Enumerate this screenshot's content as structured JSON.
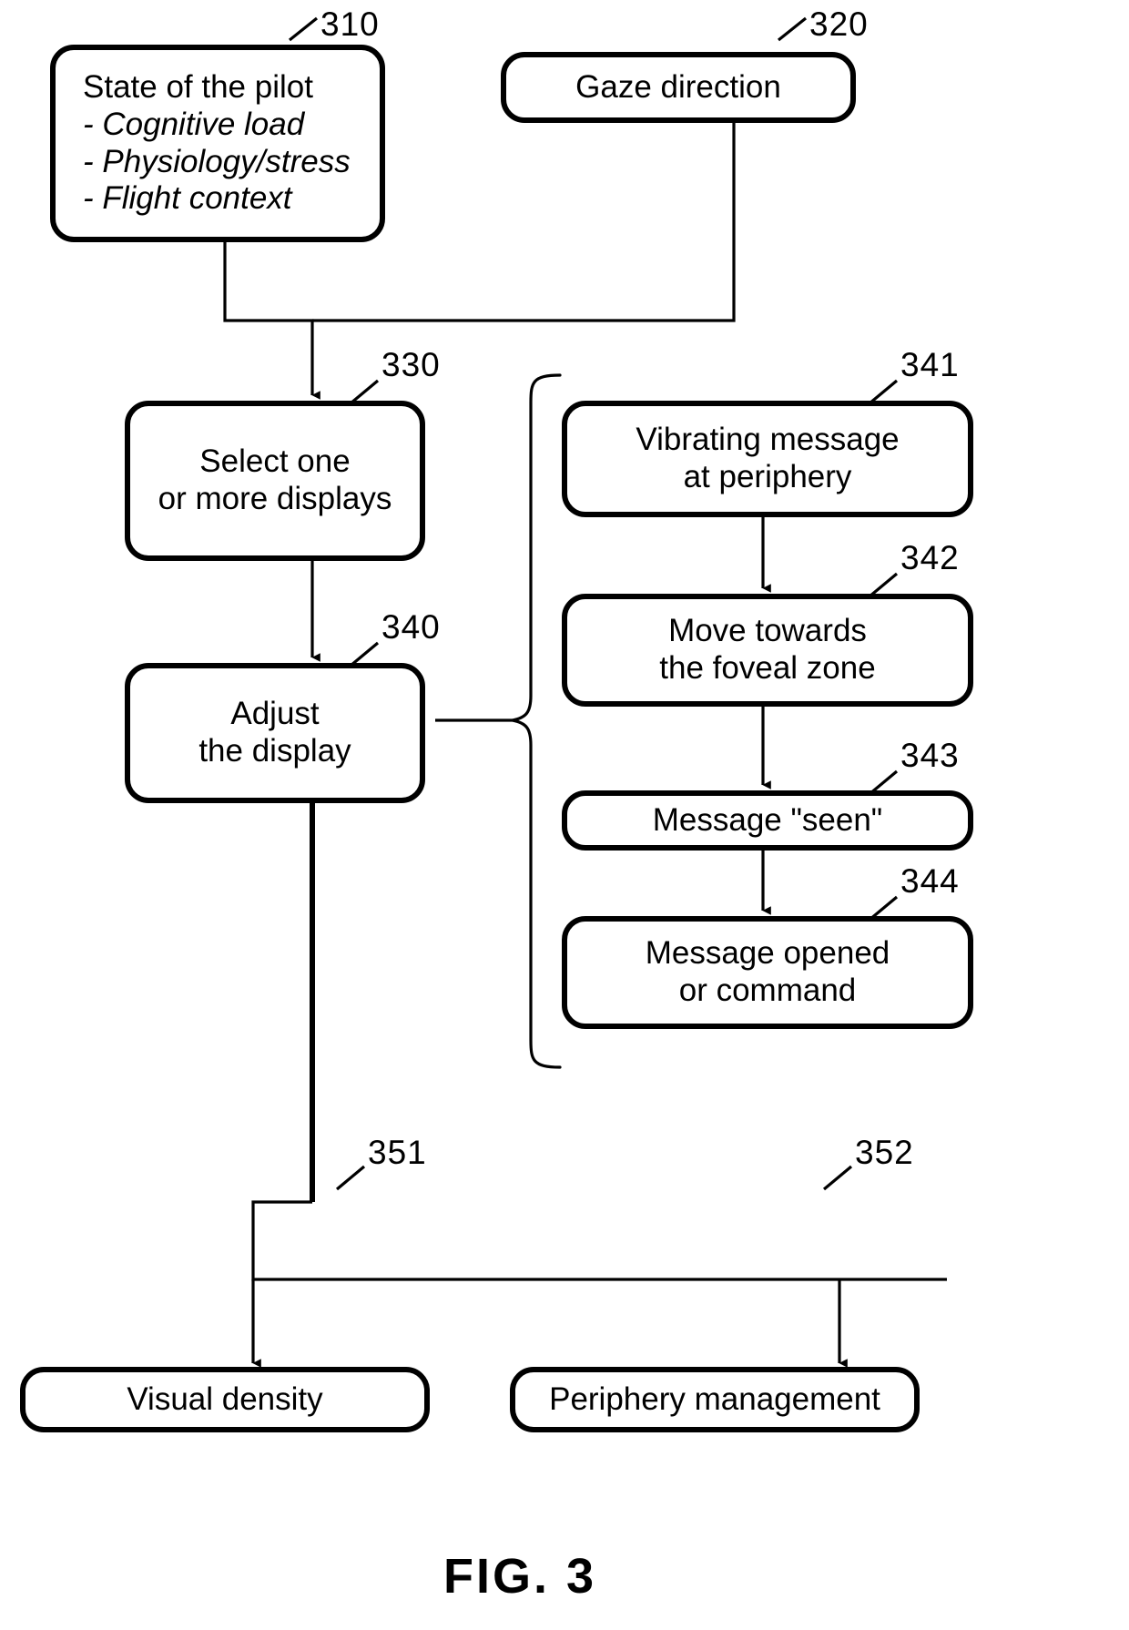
{
  "figure": {
    "caption": "FIG. 3"
  },
  "nodes": {
    "state_of_pilot": {
      "ref": "310",
      "title": "State of the pilot",
      "items": [
        "- Cognitive load",
        "- Physiology/stress",
        "- Flight context"
      ]
    },
    "gaze_direction": {
      "ref": "320",
      "lines": [
        "Gaze direction"
      ]
    },
    "select_displays": {
      "ref": "330",
      "lines": [
        "Select one",
        "or more displays"
      ]
    },
    "adjust_display": {
      "ref": "340",
      "lines": [
        "Adjust",
        "the display"
      ]
    },
    "vibrating_message": {
      "ref": "341",
      "lines": [
        "Vibrating message",
        "at periphery"
      ]
    },
    "move_foveal": {
      "ref": "342",
      "lines": [
        "Move towards",
        "the foveal zone"
      ]
    },
    "message_seen": {
      "ref": "343",
      "lines": [
        "Message \"seen\""
      ]
    },
    "message_opened": {
      "ref": "344",
      "lines": [
        "Message opened",
        "or command"
      ]
    },
    "visual_density": {
      "ref": "351",
      "lines": [
        "Visual density"
      ]
    },
    "periphery_management": {
      "ref": "352",
      "lines": [
        "Periphery management"
      ]
    }
  },
  "colors": {
    "ink": "#000000",
    "paper": "#ffffff"
  }
}
